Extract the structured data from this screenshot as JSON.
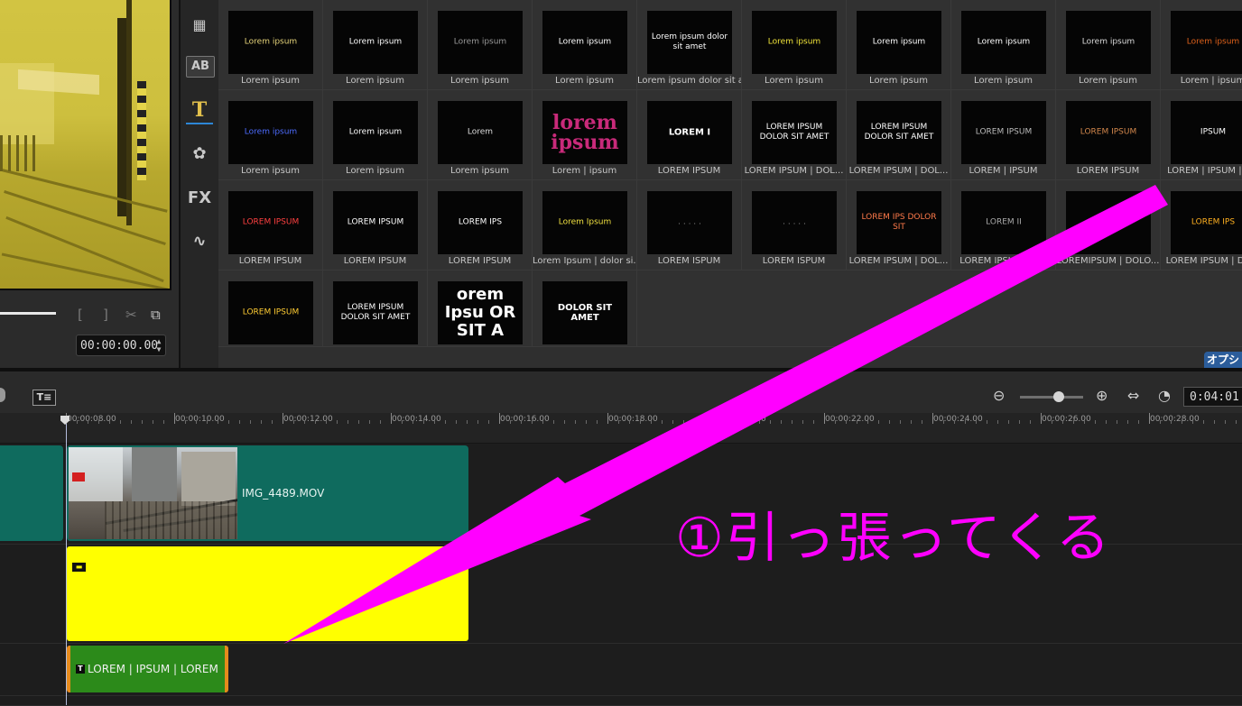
{
  "preview": {
    "timecode": "00:00:00.00",
    "controls": {
      "mark_in": "[",
      "mark_out": "]",
      "trim": "✂",
      "copy": "⧉"
    }
  },
  "library_tools": [
    {
      "name": "media",
      "glyph": "▦"
    },
    {
      "name": "transition",
      "glyph": "AB"
    },
    {
      "name": "title",
      "glyph": "T"
    },
    {
      "name": "graphic",
      "glyph": "✿"
    },
    {
      "name": "filter",
      "glyph": "FX"
    },
    {
      "name": "path",
      "glyph": "∿"
    }
  ],
  "gallery": {
    "items": [
      {
        "label": "Lorem ipsum",
        "preview": "Lorem ipsum",
        "color": "#e6d47a"
      },
      {
        "label": "Lorem ipsum",
        "preview": "Lorem ipsum",
        "color": "#ffffff"
      },
      {
        "label": "Lorem ipsum",
        "preview": "Lorem ipsum",
        "color": "#9a9a9a"
      },
      {
        "label": "Lorem ipsum",
        "preview": "Lorem ipsum",
        "color": "#ffffff"
      },
      {
        "label": "Lorem ipsum dolor sit a...",
        "preview": "Lorem ipsum dolor sit amet",
        "color": "#ffffff"
      },
      {
        "label": "Lorem ipsum",
        "preview": "Lorem ipsum",
        "color": "#f3e63a"
      },
      {
        "label": "Lorem ipsum",
        "preview": "Lorem ipsum",
        "color": "#ffffff"
      },
      {
        "label": "Lorem ipsum",
        "preview": "Lorem ipsum",
        "color": "#ffffff"
      },
      {
        "label": "Lorem ipsum",
        "preview": "Lorem ipsum",
        "color": "#dddddd"
      },
      {
        "label": "Lorem | ipsum",
        "preview": "Lorem ipsum",
        "color": "#e0621b"
      },
      {
        "label": "Lorem ipsum",
        "preview": "Lorem ipsum",
        "color": "#4d6cff"
      },
      {
        "label": "Lorem ipsum",
        "preview": "Lorem ipsum",
        "color": "#ffffff"
      },
      {
        "label": "Lorem ipsum",
        "preview": "Lorem",
        "color": "#dddddd"
      },
      {
        "label": "Lorem | ipsum",
        "preview": "lorem ipsum",
        "color": "#c92a7a"
      },
      {
        "label": "LOREM IPSUM",
        "preview": "LOREM I",
        "color": "#ffffff"
      },
      {
        "label": "LOREM IPSUM | DOL...",
        "preview": "LOREM IPSUM DOLOR SIT AMET",
        "color": "#ffffff"
      },
      {
        "label": "LOREM IPSUM | DOL...",
        "preview": "LOREM IPSUM DOLOR SIT AMET",
        "color": "#ffffff"
      },
      {
        "label": "LOREM | IPSUM",
        "preview": "LOREM IPSUM",
        "color": "#bbbbbb"
      },
      {
        "label": "LOREM IPSUM",
        "preview": "LOREM IPSUM",
        "color": "#d2874c"
      },
      {
        "label": "LOREM | IPSUM | L...",
        "preview": "IPSUM",
        "color": "#ffffff"
      },
      {
        "label": "LOREM IPSUM",
        "preview": "LOREM IPSUM",
        "color": "#ff4040"
      },
      {
        "label": "LOREM IPSUM",
        "preview": "LOREM IPSUM",
        "color": "#ffffff"
      },
      {
        "label": "LOREM IPSUM",
        "preview": "LOREM IPS",
        "color": "#ffffff"
      },
      {
        "label": "Lorem Ipsum | dolor si...",
        "preview": "Lorem Ipsum",
        "color": "#f0e040"
      },
      {
        "label": "LOREM ISPUM",
        "preview": ". . . . .",
        "color": "#888888"
      },
      {
        "label": "LOREM ISPUM",
        "preview": ". . . . .",
        "color": "#888888"
      },
      {
        "label": "LOREM IPSUM | DOL...",
        "preview": "LOREM IPS DOLOR SIT",
        "color": "#ff7a4a"
      },
      {
        "label": "LOREM IPSUM | D...",
        "preview": "LOREM II",
        "color": "#aaaaaa"
      },
      {
        "label": "LOREMIPSUM | DOLO...",
        "preview": "LOREM",
        "color": "#ffffff"
      },
      {
        "label": "LOREM IPSUM | DO...",
        "preview": "LOREM IPS",
        "color": "#ffb020"
      },
      {
        "label": "",
        "preview": "LOREM IPSUM",
        "color": "#ffcc33"
      },
      {
        "label": "",
        "preview": "LOREM IPSUM DOLOR SIT AMET",
        "color": "#ffffff"
      },
      {
        "label": "",
        "preview": "orem Ipsu OR SIT A",
        "color": "#ffffff"
      },
      {
        "label": "",
        "preview": "DOLOR SIT AMET",
        "color": "#ffffff"
      }
    ],
    "options_label": "オプシ"
  },
  "timeline": {
    "zoom_level": 0.62,
    "project_duration": "0:04:01",
    "ruler_labels": [
      "00:00:08.00",
      "00:00:10.00",
      "00:00:12.00",
      "00:00:14.00",
      "00:00:16.00",
      "00:00:18.00",
      "00:00:20.00",
      "00:00:22.00",
      "00:00:24.00",
      "00:00:26.00",
      "00:00:28.00"
    ],
    "video_clip": {
      "name": "IMG_4489.MOV",
      "color": "#0f6b5e"
    },
    "overlay_clip": {
      "color": "#ffff00"
    },
    "title_clip": {
      "label": "LOREM | IPSUM | LOREM",
      "color": "#2c8a1a"
    }
  },
  "annotation": {
    "text": "①引っ張ってくる",
    "color": "#ff00ff"
  }
}
